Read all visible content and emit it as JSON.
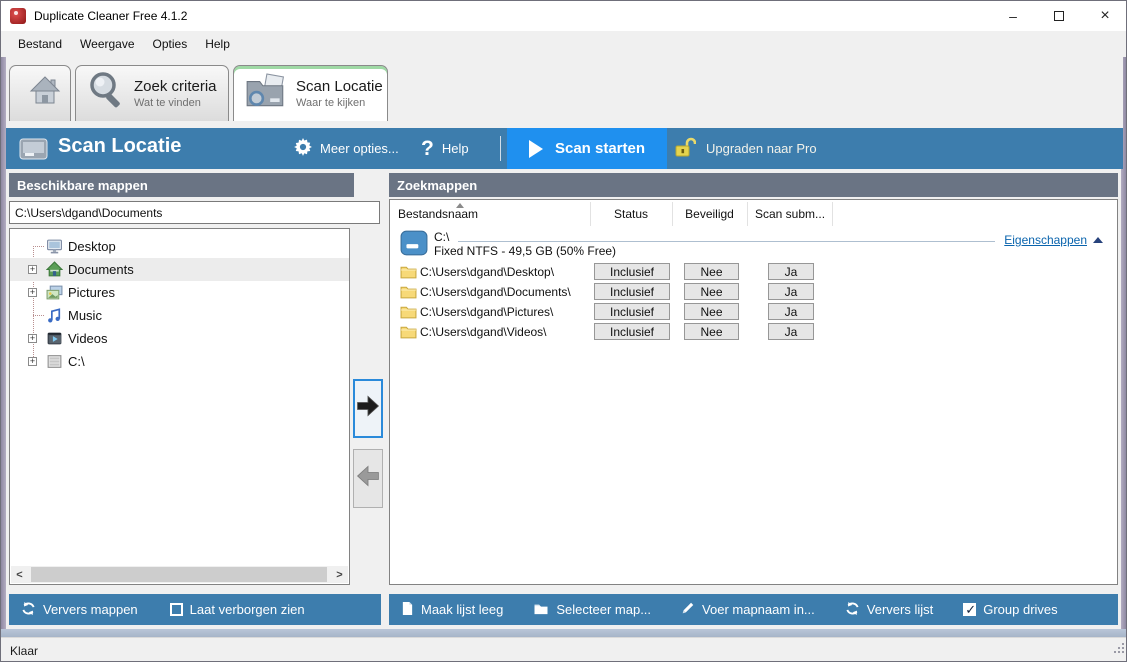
{
  "window": {
    "title": "Duplicate Cleaner Free 4.1.2",
    "minimize_glyph": "–",
    "close_glyph": "×"
  },
  "menu": {
    "items": [
      "Bestand",
      "Weergave",
      "Opties",
      "Help"
    ]
  },
  "tabs": [
    {
      "name": "home"
    },
    {
      "name": "zoek-criteria",
      "label": "Zoek criteria",
      "sublabel": "Wat te vinden"
    },
    {
      "name": "scan-locatie",
      "label": "Scan Locatie",
      "sublabel": "Waar te kijken",
      "active": true
    }
  ],
  "toolbar": {
    "title": "Scan Locatie",
    "more_options": "Meer opties...",
    "help": "Help",
    "help_glyph": "?",
    "scan_start": "Scan starten",
    "upgrade": "Upgraden naar Pro"
  },
  "left_panel": {
    "header": "Beschikbare mappen",
    "path_value": "C:\\Users\\dgand\\Documents",
    "tree": [
      {
        "label": "Desktop",
        "expandable": false,
        "selected": false
      },
      {
        "label": "Documents",
        "expandable": true,
        "selected": true
      },
      {
        "label": "Pictures",
        "expandable": true,
        "selected": false
      },
      {
        "label": "Music",
        "expandable": false,
        "selected": false
      },
      {
        "label": "Videos",
        "expandable": true,
        "selected": false
      },
      {
        "label": "C:\\",
        "expandable": true,
        "selected": false
      }
    ],
    "expander_glyph": "+",
    "footer": {
      "refresh": "Ververs mappen",
      "show_hidden": "Laat verborgen zien",
      "show_hidden_checked": false
    }
  },
  "right_panel": {
    "header": "Zoekmappen",
    "columns": [
      "Bestandsnaam",
      "Status",
      "Beveiligd",
      "Scan subm..."
    ],
    "group": {
      "name": "C:\\",
      "info": "Fixed NTFS - 49,5 GB (50% Free)",
      "properties_link": "Eigenschappen"
    },
    "rows": [
      {
        "path": "C:\\Users\\dgand\\Desktop\\",
        "status": "Inclusief",
        "beveiligd": "Nee",
        "scan_sub": "Ja"
      },
      {
        "path": "C:\\Users\\dgand\\Documents\\",
        "status": "Inclusief",
        "beveiligd": "Nee",
        "scan_sub": "Ja"
      },
      {
        "path": "C:\\Users\\dgand\\Pictures\\",
        "status": "Inclusief",
        "beveiligd": "Nee",
        "scan_sub": "Ja"
      },
      {
        "path": "C:\\Users\\dgand\\Videos\\",
        "status": "Inclusief",
        "beveiligd": "Nee",
        "scan_sub": "Ja"
      }
    ],
    "footer": {
      "clear_list": "Maak lijst leeg",
      "select_folder": "Selecteer map...",
      "enter_folder": "Voer mapnaam in...",
      "refresh_list": "Ververs lijst",
      "group_drives": "Group drives",
      "group_drives_checked": true
    }
  },
  "status_bar": {
    "text": "Klaar"
  },
  "scrollbar": {
    "left_glyph": "<",
    "right_glyph": ">"
  },
  "colors": {
    "toolbar_blue": "#3d7dad",
    "panel_header_gray": "#6a7484",
    "scan_button_blue": "#1f90ef",
    "link_blue": "#0a64ad",
    "folder_yellow": "#f7d978",
    "lock_yellow": "#e5d44e",
    "active_tab_green": "#9fd9a5",
    "tree_selection_gray": "#ececec"
  }
}
